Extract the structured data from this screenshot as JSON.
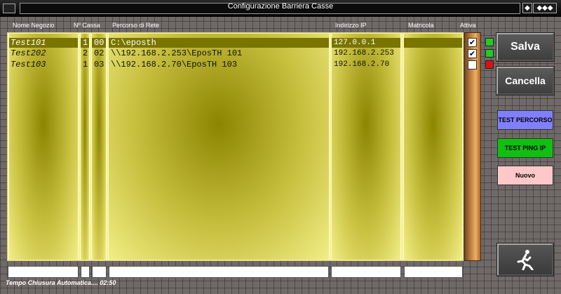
{
  "window": {
    "title": "Configurazione Barriera Casse",
    "controls": [
      "◆",
      "◆◆◆"
    ]
  },
  "columns": {
    "nome": "Nome Negozio",
    "cassa": "Nº Cassa",
    "percorso": "Percorso di Rete",
    "ip": "Indirizzo IP",
    "matricola": "Matricola",
    "attiva": "Attiva"
  },
  "rows": [
    {
      "nome": "Test101",
      "n1": "1",
      "n2": "00",
      "percorso": "C:\\eposth",
      "ip": "127.0.0.1",
      "matricola": "",
      "attiva": true,
      "status_color": "#22cc22"
    },
    {
      "nome": "Test202",
      "n1": "2",
      "n2": "02",
      "percorso": "\\\\192.168.2.253\\EposTH 101",
      "ip": "192.168.2.253",
      "matricola": "",
      "attiva": true,
      "status_color": "#22cc22"
    },
    {
      "nome": "Test103",
      "n1": "1",
      "n2": "03",
      "percorso": "\\\\192.168.2.70\\EposTH 103",
      "ip": "192.168.2.70",
      "matricola": "",
      "attiva": false,
      "status_color": "#dd1111"
    }
  ],
  "buttons": {
    "salva": "Salva",
    "cancella": "Cancella",
    "test_percorso": "TEST PERCORSO",
    "test_ping": "TEST PING IP",
    "nuovo": "Nuovo",
    "exit_icon": "running-man-exit-icon"
  },
  "colors": {
    "test_percorso_bg": "#8080ff",
    "test_ping_bg": "#10c010",
    "nuovo_bg": "#ffc8c8"
  },
  "status": {
    "text": "Tempo Chiusura Automatica.... 02:50"
  }
}
